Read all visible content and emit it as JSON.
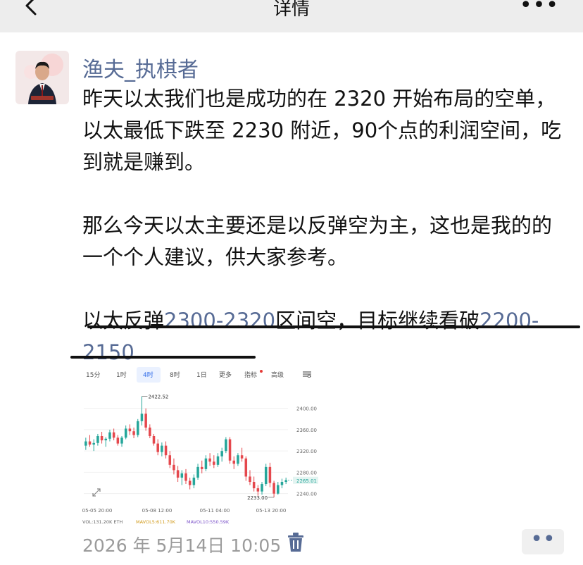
{
  "nav": {
    "title": "详情",
    "more": "•••"
  },
  "author": {
    "name": "渔夫_执棋者"
  },
  "post": {
    "para1": "昨天以太我们也是成功的在 2320 开始布局的空单，以太最低下跌至 2230 附近，90个点的利润空间，吃到就是赚到。",
    "para2": "那么今天以太主要还是以反弹空为主，这也是我的的一个个人建议，供大家参考。",
    "para3_a": "以太反弹",
    "para3_b": "2300-2320",
    "para3_c": "区间空，目标继续看破",
    "para3_d": "2200-2150"
  },
  "chart_tabs": [
    {
      "label": "15分",
      "active": false
    },
    {
      "label": "1时",
      "active": false
    },
    {
      "label": "4时",
      "active": true
    },
    {
      "label": "8时",
      "active": false
    },
    {
      "label": "1日",
      "active": false
    },
    {
      "label": "更多",
      "active": false
    },
    {
      "label": "指标",
      "active": false
    },
    {
      "label": "高级",
      "active": false
    }
  ],
  "chart_data": {
    "type": "candlestick",
    "y_ticks": [
      "2400.00",
      "2360.00",
      "2320.00",
      "2280.00",
      "2240.00"
    ],
    "x_ticks": [
      "05-05 20:00",
      "05-08 12:00",
      "05-11 04:00",
      "05-13 20:00"
    ],
    "ylim": [
      2225,
      2430
    ],
    "high_label": "2422.52",
    "low_label": "2233.00",
    "last_price": "2265.01",
    "volume_line": {
      "vol": "VOL:131.20K ETH",
      "mavol5": "MAVOL5:611.70K",
      "mavol10": "MAVOL10:550.59K"
    },
    "colors": {
      "up": "#26a69a",
      "down": "#e5484d"
    },
    "candles": [
      [
        2330,
        2345,
        2322,
        2338
      ],
      [
        2338,
        2350,
        2328,
        2332
      ],
      [
        2332,
        2342,
        2320,
        2335
      ],
      [
        2335,
        2352,
        2330,
        2348
      ],
      [
        2348,
        2356,
        2334,
        2340
      ],
      [
        2340,
        2346,
        2328,
        2343
      ],
      [
        2343,
        2360,
        2338,
        2355
      ],
      [
        2355,
        2362,
        2340,
        2345
      ],
      [
        2345,
        2350,
        2330,
        2334
      ],
      [
        2334,
        2348,
        2328,
        2345
      ],
      [
        2345,
        2368,
        2342,
        2362
      ],
      [
        2362,
        2370,
        2350,
        2357
      ],
      [
        2357,
        2364,
        2344,
        2350
      ],
      [
        2350,
        2380,
        2346,
        2376
      ],
      [
        2376,
        2422.52,
        2368,
        2390
      ],
      [
        2390,
        2400,
        2358,
        2364
      ],
      [
        2364,
        2370,
        2344,
        2348
      ],
      [
        2348,
        2352,
        2330,
        2334
      ],
      [
        2334,
        2342,
        2312,
        2318
      ],
      [
        2318,
        2336,
        2310,
        2330
      ],
      [
        2330,
        2338,
        2306,
        2312
      ],
      [
        2312,
        2320,
        2288,
        2294
      ],
      [
        2294,
        2306,
        2276,
        2284
      ],
      [
        2284,
        2292,
        2262,
        2270
      ],
      [
        2270,
        2284,
        2256,
        2278
      ],
      [
        2278,
        2286,
        2258,
        2264
      ],
      [
        2264,
        2270,
        2248,
        2256
      ],
      [
        2256,
        2276,
        2250,
        2270
      ],
      [
        2270,
        2296,
        2266,
        2290
      ],
      [
        2290,
        2302,
        2278,
        2286
      ],
      [
        2286,
        2312,
        2282,
        2306
      ],
      [
        2306,
        2316,
        2292,
        2300
      ],
      [
        2300,
        2312,
        2288,
        2294
      ],
      [
        2294,
        2316,
        2290,
        2310
      ],
      [
        2310,
        2326,
        2300,
        2320
      ],
      [
        2320,
        2346,
        2316,
        2342
      ],
      [
        2342,
        2346,
        2296,
        2302
      ],
      [
        2302,
        2310,
        2286,
        2296
      ],
      [
        2296,
        2316,
        2292,
        2312
      ],
      [
        2312,
        2326,
        2300,
        2306
      ],
      [
        2306,
        2310,
        2264,
        2272
      ],
      [
        2272,
        2284,
        2256,
        2262
      ],
      [
        2262,
        2272,
        2244,
        2250
      ],
      [
        2250,
        2256,
        2236,
        2244
      ],
      [
        2244,
        2262,
        2238,
        2258
      ],
      [
        2258,
        2296,
        2254,
        2290
      ],
      [
        2290,
        2298,
        2252,
        2260
      ],
      [
        2260,
        2264,
        2233,
        2240
      ],
      [
        2240,
        2262,
        2238,
        2256
      ],
      [
        2256,
        2268,
        2250,
        2262
      ],
      [
        2262,
        2270,
        2258,
        2265
      ]
    ]
  },
  "footer": {
    "timestamp": "2026 年 5月14日 10:05",
    "comment_dots": "••"
  }
}
